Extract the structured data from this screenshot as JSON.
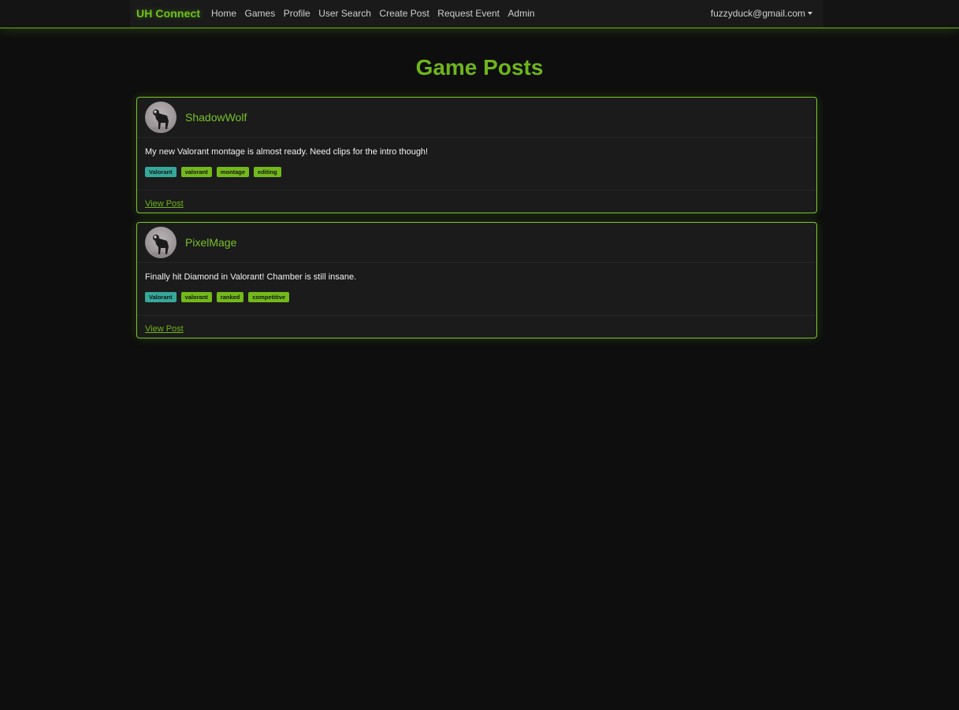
{
  "navbar": {
    "brand": "UH Connect",
    "links": [
      "Home",
      "Games",
      "Profile",
      "User Search",
      "Create Post",
      "Request Event",
      "Admin"
    ],
    "user_email": "fuzzyduck@gmail.com"
  },
  "page": {
    "title": "Game Posts"
  },
  "posts": [
    {
      "username": "ShadowWolf",
      "text": "My new Valorant montage is almost ready. Need clips for the intro though!",
      "tags": [
        "Valorant",
        "valorant",
        "montage",
        "editing"
      ],
      "link_label": "View Post"
    },
    {
      "username": "PixelMage",
      "text": "Finally hit Diamond in Valorant! Chamber is still insane.",
      "tags": [
        "Valorant",
        "valorant",
        "ranked",
        "competitive"
      ],
      "link_label": "View Post"
    }
  ],
  "colors": {
    "accent": "#6fb51c",
    "game_tag": "#36a89a",
    "background": "#0e0e0e"
  }
}
